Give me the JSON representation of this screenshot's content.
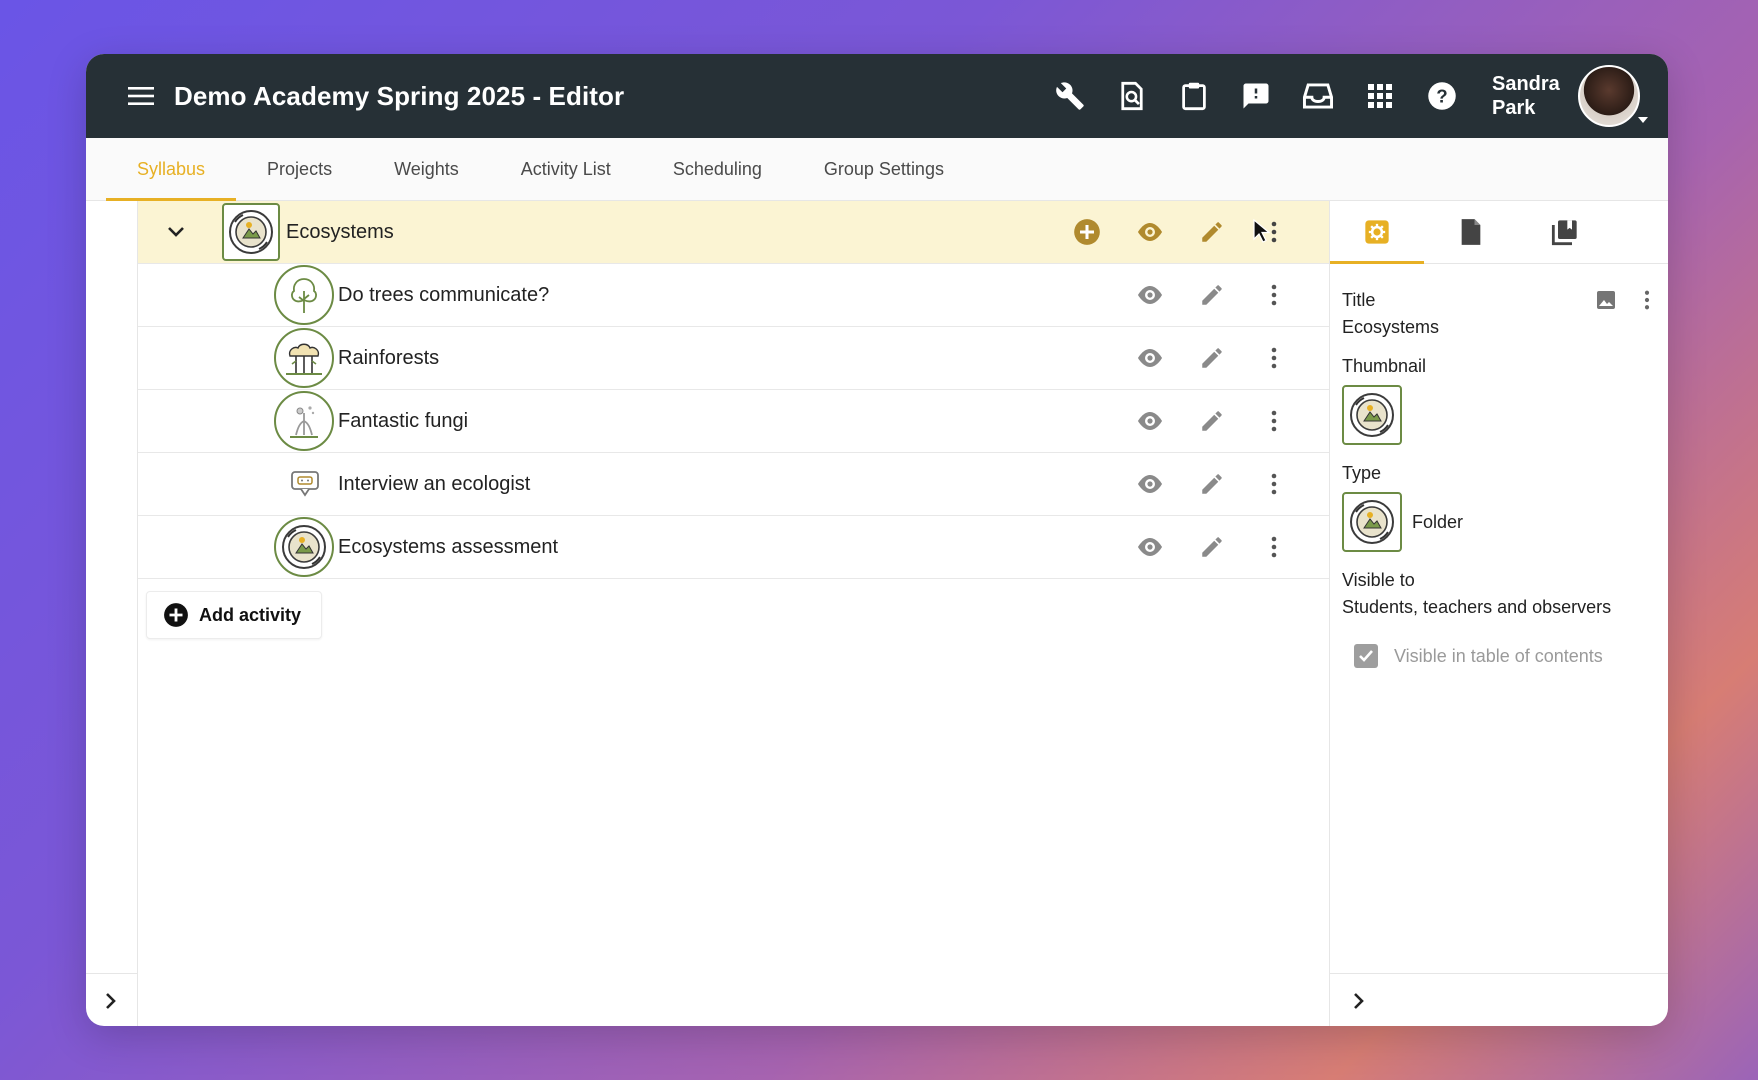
{
  "header": {
    "title": "Demo Academy Spring 2025 - Editor",
    "user_first": "Sandra",
    "user_last": "Park",
    "icons": [
      "wrench-icon",
      "search-document-icon",
      "clipboard-icon",
      "feedback-icon",
      "inbox-icon",
      "apps-grid-icon",
      "help-icon"
    ]
  },
  "tabs": [
    {
      "label": "Syllabus",
      "active": true
    },
    {
      "label": "Projects"
    },
    {
      "label": "Weights"
    },
    {
      "label": "Activity List"
    },
    {
      "label": "Scheduling"
    },
    {
      "label": "Group Settings"
    }
  ],
  "syllabus": {
    "folder": {
      "label": "Ecosystems"
    },
    "items": [
      {
        "label": "Do trees communicate?",
        "thumb": "tree"
      },
      {
        "label": "Rainforests",
        "thumb": "rainforest"
      },
      {
        "label": "Fantastic fungi",
        "thumb": "fungi"
      },
      {
        "label": "Interview an ecologist",
        "thumb": "chat"
      },
      {
        "label": "Ecosystems assessment",
        "thumb": "ecosystem"
      }
    ],
    "add_activity_label": "Add activity"
  },
  "properties": {
    "title_label": "Title",
    "title_value": "Ecosystems",
    "thumbnail_label": "Thumbnail",
    "type_label": "Type",
    "type_value": "Folder",
    "visible_label": "Visible to",
    "visible_value": "Students, teachers and observers",
    "toc_label": "Visible in table of contents",
    "toc_checked": true
  },
  "colors": {
    "accent": "#e7b024",
    "topbar": "#263036",
    "folder_row": "#fbf4d3",
    "thumb_border": "#6c8b44",
    "folder_action": "#b08a2e"
  }
}
